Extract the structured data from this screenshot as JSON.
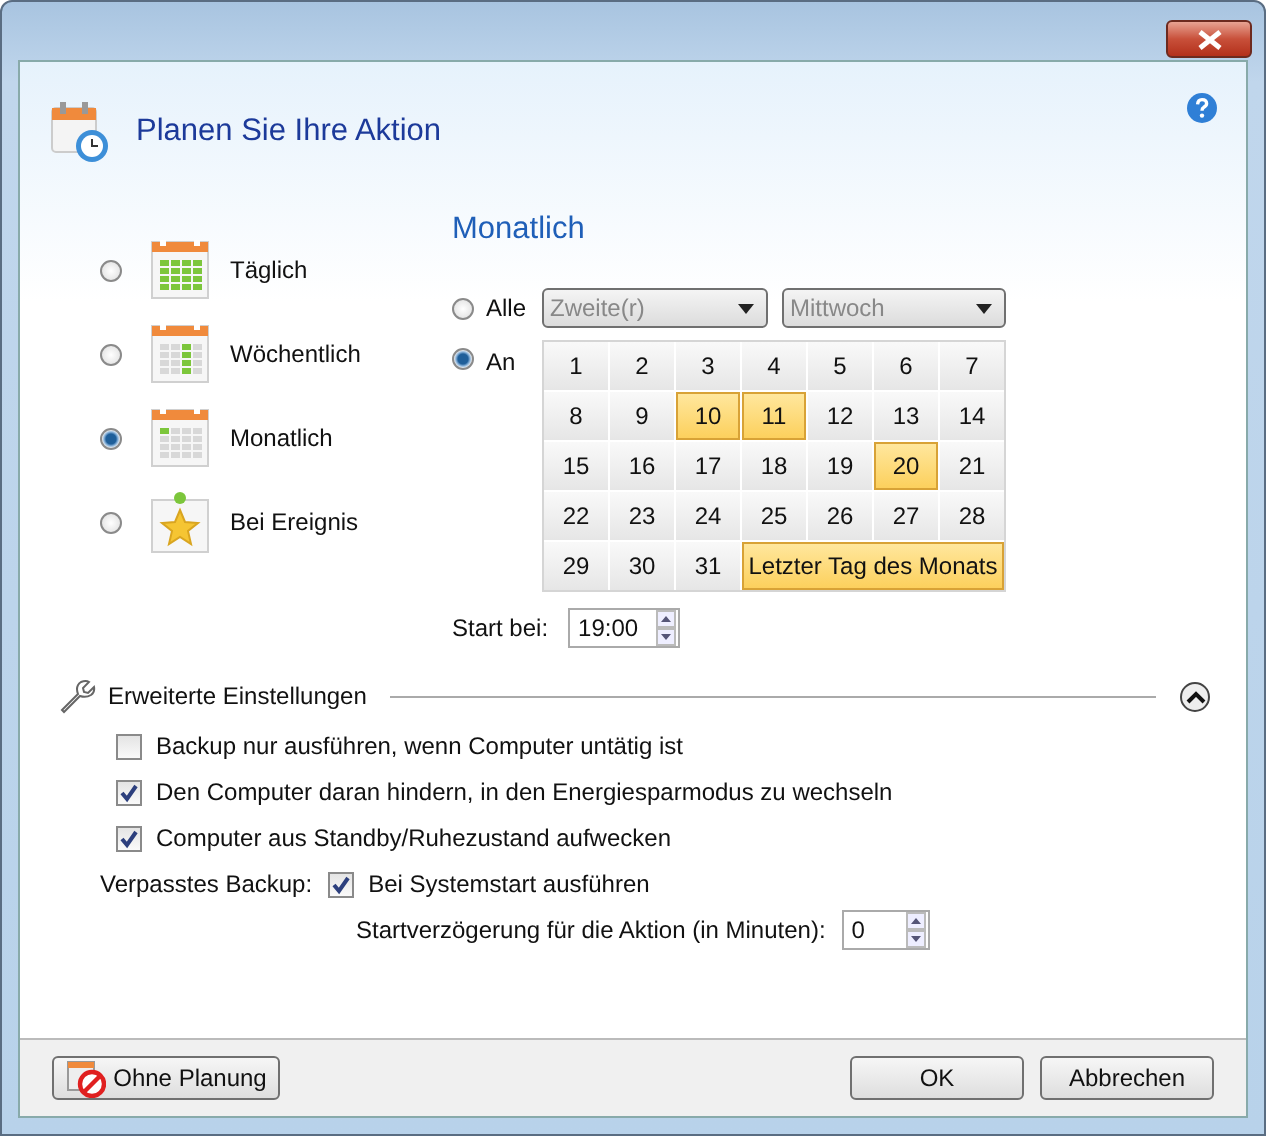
{
  "header": {
    "title": "Planen Sie Ihre Aktion"
  },
  "schedule_options": [
    {
      "label": "Täglich",
      "kind": "daily",
      "selected": false
    },
    {
      "label": "Wöchentlich",
      "kind": "weekly",
      "selected": false
    },
    {
      "label": "Monatlich",
      "kind": "monthly",
      "selected": true
    },
    {
      "label": "Bei Ereignis",
      "kind": "event",
      "selected": false
    }
  ],
  "monthly": {
    "title": "Monatlich",
    "modes": [
      {
        "label": "Alle",
        "selected": false
      },
      {
        "label": "An",
        "selected": true
      }
    ],
    "ordinal_dropdown": "Zweite(r)",
    "weekday_dropdown": "Mittwoch",
    "days": [
      {
        "label": "1",
        "selected": false
      },
      {
        "label": "2",
        "selected": false
      },
      {
        "label": "3",
        "selected": false
      },
      {
        "label": "4",
        "selected": false
      },
      {
        "label": "5",
        "selected": false
      },
      {
        "label": "6",
        "selected": false
      },
      {
        "label": "7",
        "selected": false
      },
      {
        "label": "8",
        "selected": false
      },
      {
        "label": "9",
        "selected": false
      },
      {
        "label": "10",
        "selected": true
      },
      {
        "label": "11",
        "selected": true
      },
      {
        "label": "12",
        "selected": false
      },
      {
        "label": "13",
        "selected": false
      },
      {
        "label": "14",
        "selected": false
      },
      {
        "label": "15",
        "selected": false
      },
      {
        "label": "16",
        "selected": false
      },
      {
        "label": "17",
        "selected": false
      },
      {
        "label": "18",
        "selected": false
      },
      {
        "label": "19",
        "selected": false
      },
      {
        "label": "20",
        "selected": true
      },
      {
        "label": "21",
        "selected": false
      },
      {
        "label": "22",
        "selected": false
      },
      {
        "label": "23",
        "selected": false
      },
      {
        "label": "24",
        "selected": false
      },
      {
        "label": "25",
        "selected": false
      },
      {
        "label": "26",
        "selected": false
      },
      {
        "label": "27",
        "selected": false
      },
      {
        "label": "28",
        "selected": false
      },
      {
        "label": "29",
        "selected": false
      },
      {
        "label": "30",
        "selected": false
      },
      {
        "label": "31",
        "selected": false
      }
    ],
    "last_day": {
      "label": "Letzter Tag des Monats",
      "selected": true
    },
    "start_label": "Start bei:",
    "start_time": "19:00"
  },
  "advanced": {
    "title": "Erweiterte Einstellungen",
    "expanded": true,
    "options": [
      {
        "label": "Backup nur ausführen, wenn Computer untätig ist",
        "checked": false
      },
      {
        "label": "Den Computer daran hindern, in den Energiesparmodus zu wechseln",
        "checked": true
      },
      {
        "label": "Computer aus Standby/Ruhezustand aufwecken",
        "checked": true
      }
    ],
    "missed_label": "Verpasstes Backup:",
    "missed_option": {
      "label": "Bei Systemstart ausführen",
      "checked": true
    },
    "delay_label": "Startverzögerung für die Aktion (in Minuten):",
    "delay_value": "0"
  },
  "footer": {
    "no_schedule_button": "Ohne Planung",
    "ok_button": "OK",
    "cancel_button": "Abbrechen"
  }
}
